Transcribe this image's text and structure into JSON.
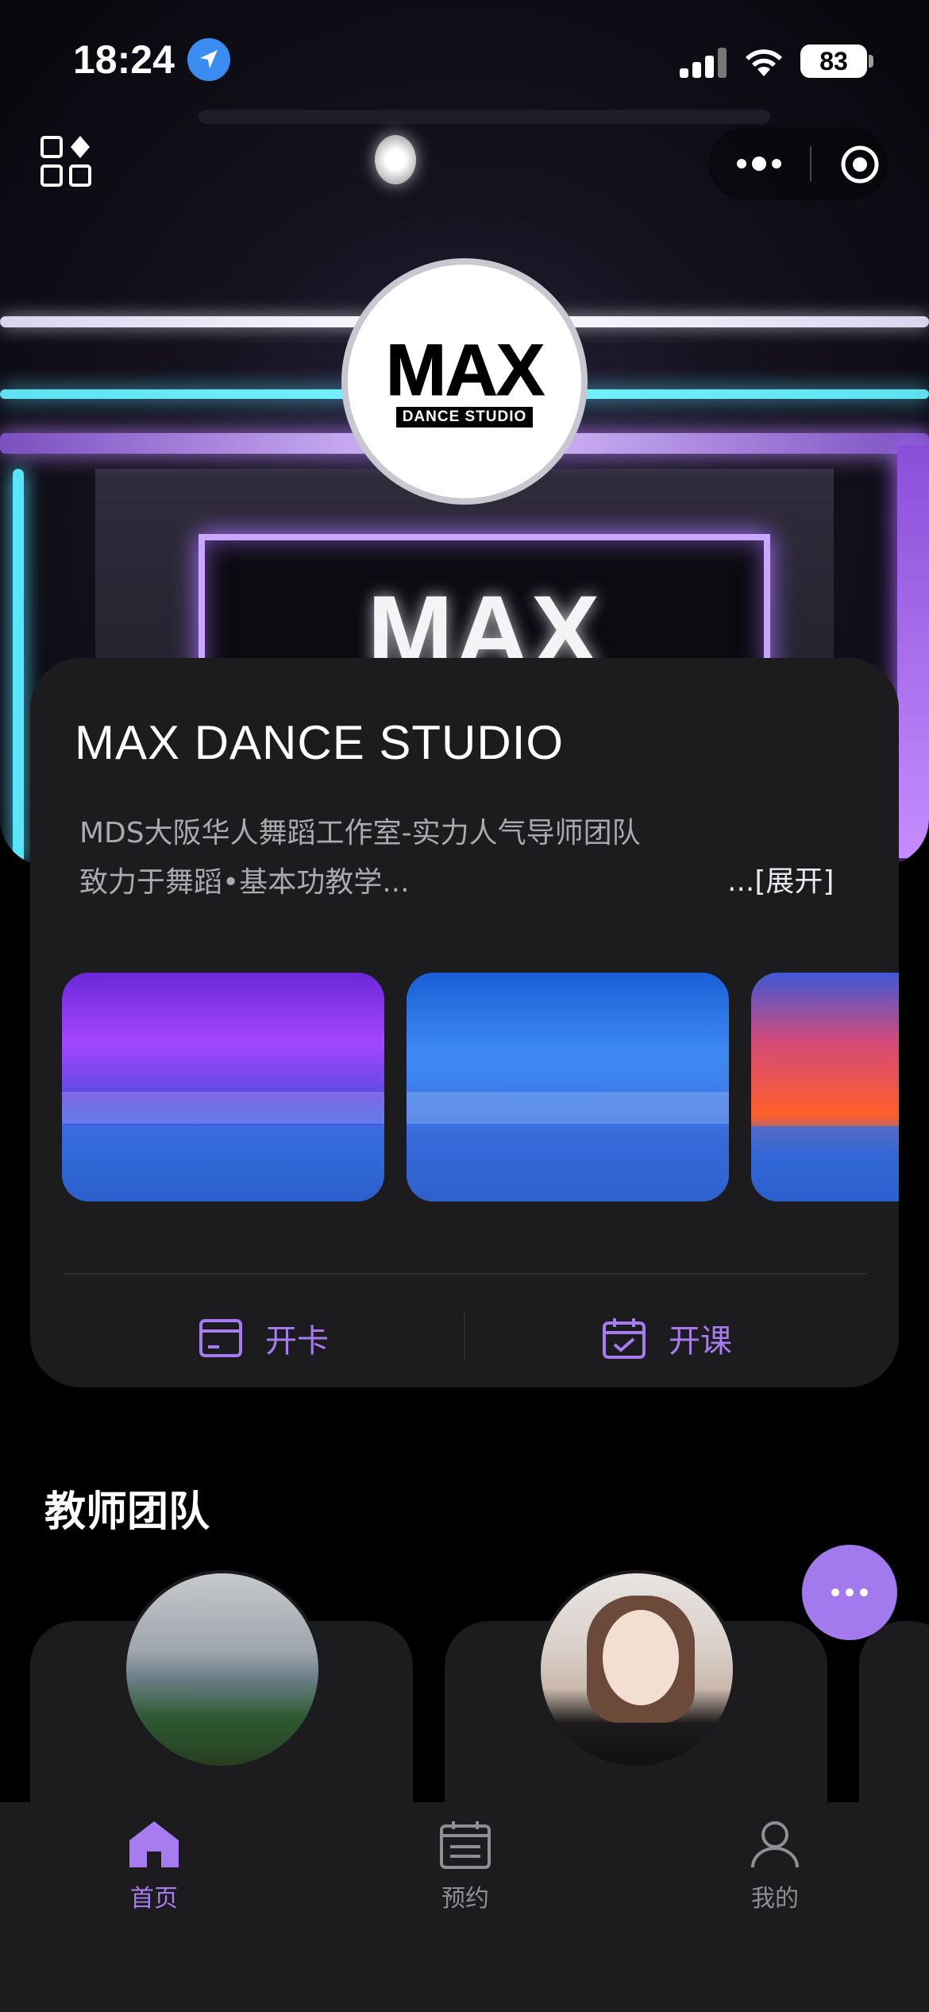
{
  "status_bar": {
    "time": "18:24",
    "battery": "83"
  },
  "hero": {
    "stage_sign": "MAX",
    "logo_main": "MAX",
    "logo_sub": "DANCE STUDIO"
  },
  "studio": {
    "name": "MAX DANCE STUDIO",
    "description_line1": "MDS大阪华人舞蹈工作室-实力人气导师团队",
    "description_line2": "致力于舞蹈•基本功教学...",
    "expand_label": "...[展开]",
    "actions": {
      "open_card": "开卡",
      "open_class": "开课"
    }
  },
  "teachers": {
    "title": "教师团队"
  },
  "tab_bar": {
    "home": "首页",
    "booking": "预约",
    "mine": "我的",
    "active": "home"
  },
  "colors": {
    "accent": "#a77cf0",
    "card_bg": "#1c1c1e",
    "page_bg": "#000000"
  }
}
